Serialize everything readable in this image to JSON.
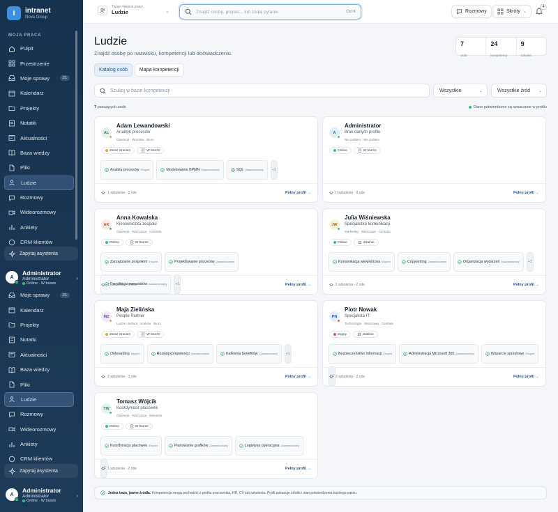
{
  "app": {
    "name": "intranet",
    "org": "Nova Group",
    "logo_letter": "i"
  },
  "sidebar": {
    "section": "MOJA PRACA",
    "items": [
      {
        "label": "Pulpit",
        "icon": "home-icon"
      },
      {
        "label": "Przestrzenie",
        "icon": "grid-icon"
      },
      {
        "label": "Moje sprawy",
        "icon": "inbox-icon",
        "count": "21"
      },
      {
        "label": "Kalendarz",
        "icon": "calendar-icon"
      },
      {
        "label": "Projekty",
        "icon": "folder-icon"
      },
      {
        "label": "Notatki",
        "icon": "note-icon"
      },
      {
        "label": "Aktualności",
        "icon": "news-icon"
      },
      {
        "label": "Baza wiedzy",
        "icon": "book-icon"
      },
      {
        "label": "Pliki",
        "icon": "file-icon"
      },
      {
        "label": "Ludzie",
        "icon": "people-icon",
        "active": true
      },
      {
        "label": "Rozmowy",
        "icon": "chat-icon"
      },
      {
        "label": "Wideorozmowy",
        "icon": "video-icon"
      },
      {
        "label": "Ankiety",
        "icon": "poll-icon"
      },
      {
        "label": "CRM klientów",
        "icon": "crm-icon"
      }
    ],
    "items_second": [
      {
        "label": "Moje sprawy",
        "icon": "inbox-icon",
        "count": "21"
      },
      {
        "label": "Kalendarz",
        "icon": "calendar-icon"
      },
      {
        "label": "Projekty",
        "icon": "folder-icon"
      },
      {
        "label": "Notatki",
        "icon": "note-icon"
      },
      {
        "label": "Aktualności",
        "icon": "news-icon"
      },
      {
        "label": "Baza wiedzy",
        "icon": "book-icon"
      },
      {
        "label": "Pliki",
        "icon": "file-icon"
      },
      {
        "label": "Ludzie",
        "icon": "people-icon",
        "active": true
      },
      {
        "label": "Rozmowy",
        "icon": "chat-icon"
      },
      {
        "label": "Wideorozmowy",
        "icon": "video-icon"
      },
      {
        "label": "Ankiety",
        "icon": "poll-icon"
      },
      {
        "label": "CRM klientów",
        "icon": "crm-icon"
      }
    ],
    "assistant": "Zapytaj asystenta",
    "user": {
      "initial": "A",
      "name": "Administrator",
      "role": "Administrator",
      "status": "Online · W biurze"
    }
  },
  "topbar": {
    "workspace_label": "Twoje miejsce pracy",
    "workspace_value": "Ludzie",
    "search_placeholder": "Znajdź osobę, projekt... lub zadaj pytanie",
    "shortcut": "Ctrl K",
    "chats": "Rozmowy",
    "shortcuts": "Skróty",
    "notif_count": "4"
  },
  "page": {
    "title": "Ludzie",
    "subtitle": "Znajdź osobę po nazwisku, kompetencji lub doświadczeniu.",
    "stats": [
      {
        "value": "7",
        "label": "osób"
      },
      {
        "value": "24",
        "label": "kompetencji"
      },
      {
        "value": "9",
        "label": "szkoleń"
      }
    ],
    "tabs": [
      "Katalog osób",
      "Mapa kompetencji"
    ],
    "filter_placeholder": "Szukaj w bazie kompetencji",
    "filter_all": "Wszystkie",
    "filter_sources": "Wszystkie źród",
    "count_num": "7",
    "count_text": " pasujących osób",
    "note": "Dane potwierdzone są oznaczone w profilu",
    "footer_bold": "Jedna baza, jawne źródła.",
    "footer_text": " Kompetencje mogą pochodzić z profilu pracownika, HR, CV lub szkolenia. Profil pokazuje źródło i stan potwierdzenia każdego wpisu."
  },
  "people": [
    {
      "initials": "AL",
      "name": "Adam Lewandowski",
      "role": "Analityk procesów",
      "meta": "Operacje · Wrocław · Biuro",
      "av_bg": "#e6f3ec",
      "av_fg": "#2f7a52",
      "dot": "#e8a23a",
      "pills": [
        {
          "label": "Zaraz wracam",
          "color": "#e8a23a"
        },
        {
          "label": "W biurze"
        }
      ],
      "skills": [
        {
          "name": "Analiza procesów",
          "level": "Ekspert"
        },
        {
          "name": "Modelowanie BPMN",
          "level": "Zaawansowany"
        },
        {
          "name": "SQL",
          "level": "Zaawansowany"
        }
      ],
      "more": "+1",
      "meta_foot": "1 szkolenia · 2 role",
      "link": "Pełny profil"
    },
    {
      "initials": "A",
      "name": "Administrator",
      "role": "Brak danych profilu",
      "meta": "Nie podano · Nie podano",
      "av_bg": "#e4eef9",
      "av_fg": "#2a5d93",
      "dot": "#36c37d",
      "pills": [
        {
          "label": "Online",
          "color": "#36c37d"
        },
        {
          "label": "W biurze"
        }
      ],
      "skills": [],
      "more": "",
      "meta_foot": "0 szkolenia · 0 role",
      "link": "Pełny profil"
    },
    {
      "initials": "AK",
      "name": "Anna Kowalska",
      "role": "Kierowniczka zespołu",
      "meta": "Operacje · Warszawa · Centrala",
      "av_bg": "#fbe9e4",
      "av_fg": "#b4533a",
      "dot": "#36c37d",
      "pills": [
        {
          "label": "Online",
          "color": "#36c37d"
        },
        {
          "label": "W biurze"
        }
      ],
      "skills": [
        {
          "name": "Zarządzanie zespołem",
          "level": "Ekspert"
        },
        {
          "name": "Projektowanie procesów",
          "level": "Zaawansowany"
        },
        {
          "name": "Facylitacja warsztatów",
          "level": "Zaawansowany"
        }
      ],
      "more": "+1",
      "meta_foot": "2 szkolenia · 2 role",
      "link": "Pełny profil"
    },
    {
      "initials": "JW",
      "name": "Julia Wiśniewska",
      "role": "Specjalistka komunikacji",
      "meta": "Marketing · Warszawa · Centrala",
      "av_bg": "#fcefd9",
      "av_fg": "#a06814",
      "dot": "#36c37d",
      "pills": [
        {
          "label": "Online",
          "color": "#36c37d"
        },
        {
          "label": "Zdalnie"
        }
      ],
      "skills": [
        {
          "name": "Komunikacja wewnętrzna",
          "level": "Ekspert"
        },
        {
          "name": "Copywriting",
          "level": "Zaawansowany"
        },
        {
          "name": "Organizacja wydarzeń",
          "level": "Zaawansowany"
        }
      ],
      "more": "+1",
      "meta_foot": "1 szkolenia · 2 role",
      "link": "Pełny profil"
    },
    {
      "initials": "MZ",
      "name": "Maja Zielińska",
      "role": "People Partner",
      "meta": "Ludzie i kultura · Kraków · Biuro",
      "av_bg": "#efe8f8",
      "av_fg": "#6b4aa3",
      "dot": "#e8a23a",
      "pills": [
        {
          "label": "Zaraz wracam",
          "color": "#e8a23a"
        },
        {
          "label": "W biurze"
        }
      ],
      "skills": [
        {
          "name": "Onboarding",
          "level": "Ekspert"
        },
        {
          "name": "Rozwój kompetencji",
          "level": "Zaawansowany"
        },
        {
          "name": "Kafeteria benefitów",
          "level": "Zaawansowany"
        }
      ],
      "more": "+1",
      "meta_foot": "2 szkolenia · 3 role",
      "link": "Pełny profil"
    },
    {
      "initials": "PN",
      "name": "Piotr Nowak",
      "role": "Specjalista IT",
      "meta": "Technologia · Warszawa · Centrala",
      "av_bg": "#e4eef9",
      "av_fg": "#2a5d93",
      "dot": "#e05a4a",
      "pills": [
        {
          "label": "Zajęty",
          "color": "#e05a4a"
        },
        {
          "label": "Zdalnie"
        }
      ],
      "skills": [
        {
          "name": "Bezpieczeństwo informacji",
          "level": "Ekspert"
        },
        {
          "name": "Administracja Microsoft 365",
          "level": "Zaawansowany"
        },
        {
          "name": "Wsparcie sprzętowe",
          "level": "Ekspert"
        }
      ],
      "more": "+1",
      "meta_foot": "2 szkolenia · 2 role",
      "link": "Pełny profil"
    },
    {
      "initials": "TW",
      "name": "Tomasz Wójcik",
      "role": "Koordynator placówek",
      "meta": "Operacje · Warszawa · Mokotów",
      "av_bg": "#e6f3ec",
      "av_fg": "#2f7a52",
      "dot": "#36c37d",
      "pills": [
        {
          "label": "Online",
          "color": "#36c37d"
        },
        {
          "label": "W biurze"
        }
      ],
      "skills": [
        {
          "name": "Koordynacja placówek",
          "level": "Ekspert"
        },
        {
          "name": "Planowanie grafików",
          "level": "Zaawansowany"
        },
        {
          "name": "Logistyka operacyjna",
          "level": "Zaawansowany"
        }
      ],
      "more": "+1",
      "meta_foot": "1 szkolenia · 2 role",
      "link": "Pełny profil"
    }
  ]
}
